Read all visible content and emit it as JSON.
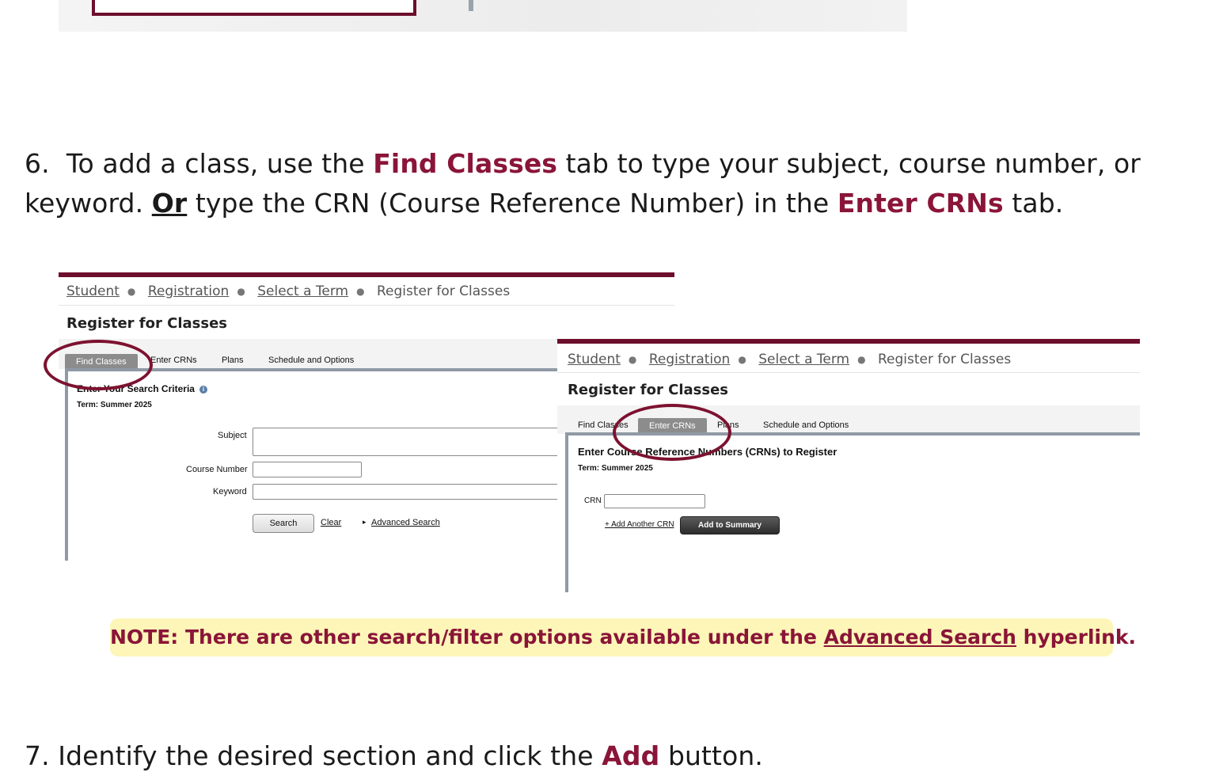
{
  "step6": {
    "number": "6.",
    "part1": "To add a class, use the ",
    "find_classes": "Find Classes",
    "part2": " tab to type your subject, course number, or",
    "part3": "keyword. ",
    "or": "Or",
    "part4": " type the CRN (Course Reference Number) in the ",
    "enter_crns": "Enter CRNs",
    "part5": " tab."
  },
  "shot_left": {
    "breadcrumb": [
      "Student",
      "Registration",
      "Select a Term"
    ],
    "breadcrumb_current": "Register for Classes",
    "title": "Register for Classes",
    "tabs": [
      "Find Classes",
      "Enter CRNs",
      "Plans",
      "Schedule and Options"
    ],
    "criteria_heading": "Enter Your Search Criteria",
    "term": "Term: Summer 2025",
    "fields": {
      "subject": "Subject",
      "course_number": "Course Number",
      "keyword": "Keyword"
    },
    "search_button": "Search",
    "clear_link": "Clear",
    "advanced_link": "Advanced Search"
  },
  "shot_right": {
    "breadcrumb": [
      "Student",
      "Registration",
      "Select a Term"
    ],
    "breadcrumb_current": "Register for Classes",
    "title": "Register for Classes",
    "tabs": [
      "Find Classes",
      "Enter CRNs",
      "Plans",
      "Schedule and Options"
    ],
    "heading": "Enter Course Reference Numbers (CRNs) to Register",
    "term": "Term: Summer 2025",
    "crn_label": "CRN",
    "add_another": "+ Add Another CRN",
    "add_summary": "Add to Summary"
  },
  "note": {
    "prefix": "NOTE:  There are other search/filter options available under the ",
    "link": "Advanced Search",
    "suffix": " hyperlink."
  },
  "step7": {
    "part1": "7.  Identify the desired section and click the ",
    "add": "Add",
    "part2": " button."
  },
  "colors": {
    "maroon": "#8a1538",
    "note_bg": "#fdf6b8"
  }
}
